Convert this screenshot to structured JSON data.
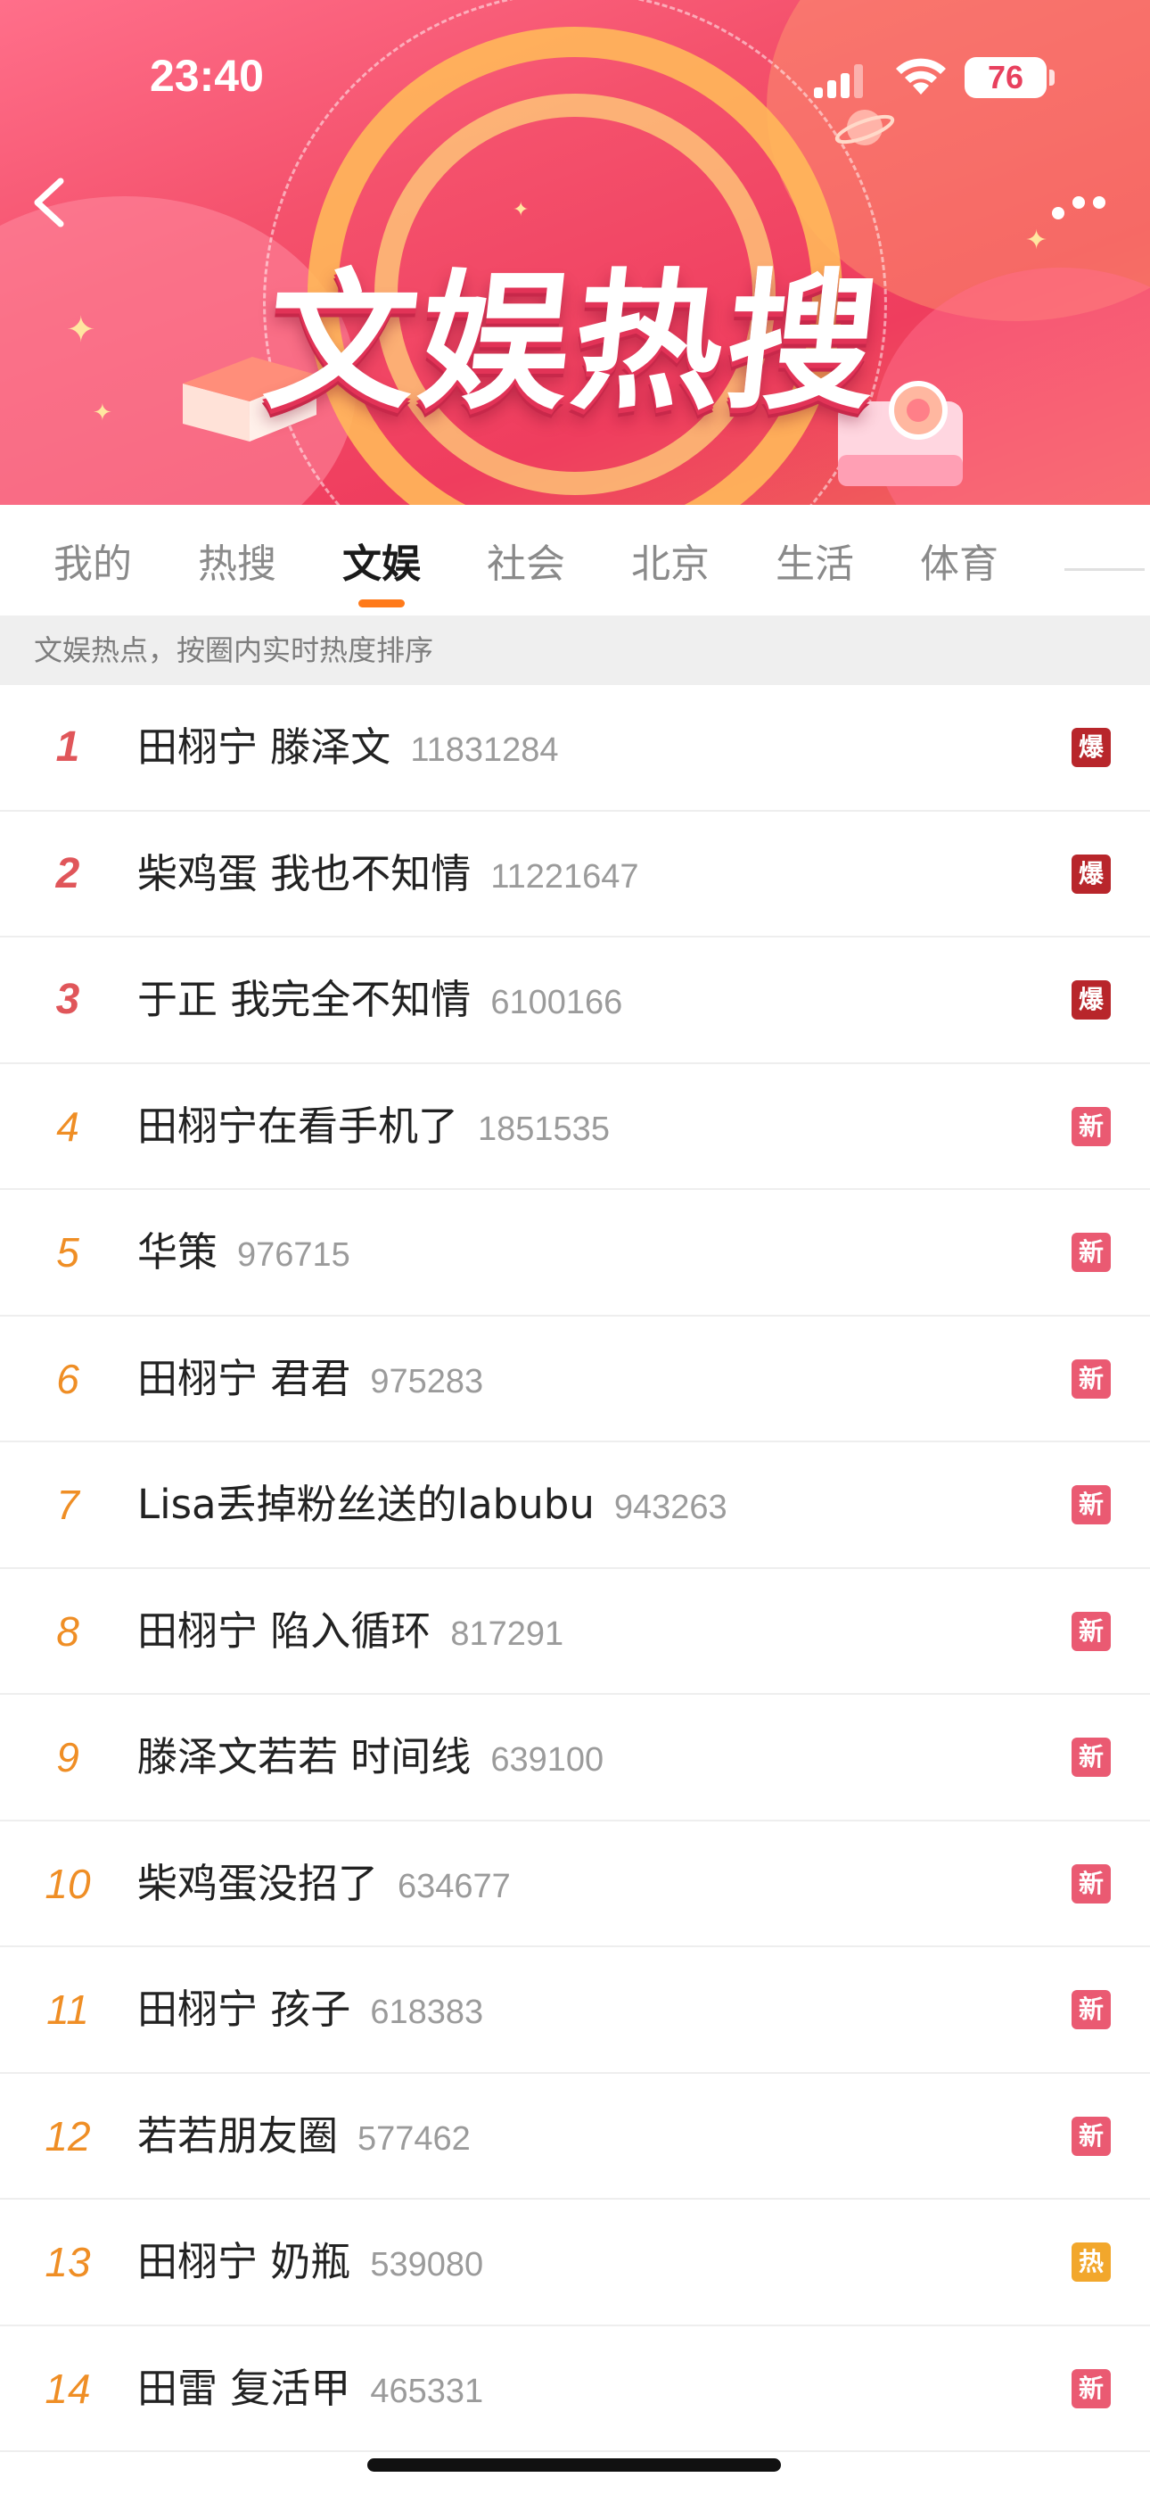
{
  "status_bar": {
    "time": "23:40",
    "battery": "76",
    "icons": [
      "signal-icon",
      "wifi-icon",
      "battery-icon"
    ]
  },
  "banner": {
    "title": "文娱热搜",
    "back_icon": "back-chevron-icon",
    "more_icon": "more-dots-icon"
  },
  "tabs": [
    {
      "label": "我的",
      "active": false
    },
    {
      "label": "热搜",
      "active": false
    },
    {
      "label": "文娱",
      "active": true
    },
    {
      "label": "社会",
      "active": false
    },
    {
      "label": "北京",
      "active": false
    },
    {
      "label": "生活",
      "active": false
    },
    {
      "label": "体育",
      "active": false
    }
  ],
  "hint": "文娱热点，按圈内实时热度排序",
  "colors": {
    "accent": "#ff7a1a",
    "rank_top": "#e0565a",
    "rank": "#ef8e25",
    "badge_bao": "#b8262b",
    "badge_xin": "#ea5a72",
    "badge_re": "#f2a72c"
  },
  "items": [
    {
      "rank": "1",
      "title": "田栩宁 滕泽文",
      "count": "11831284",
      "badge": "爆"
    },
    {
      "rank": "2",
      "title": "柴鸡蛋 我也不知情",
      "count": "11221647",
      "badge": "爆"
    },
    {
      "rank": "3",
      "title": "于正 我完全不知情",
      "count": "6100166",
      "badge": "爆"
    },
    {
      "rank": "4",
      "title": "田栩宁在看手机了",
      "count": "1851535",
      "badge": "新"
    },
    {
      "rank": "5",
      "title": "华策",
      "count": "976715",
      "badge": "新"
    },
    {
      "rank": "6",
      "title": "田栩宁 君君",
      "count": "975283",
      "badge": "新"
    },
    {
      "rank": "7",
      "title": "Lisa丢掉粉丝送的labubu",
      "count": "943263",
      "badge": "新"
    },
    {
      "rank": "8",
      "title": "田栩宁 陷入循环",
      "count": "817291",
      "badge": "新"
    },
    {
      "rank": "9",
      "title": "滕泽文若若 时间线",
      "count": "639100",
      "badge": "新"
    },
    {
      "rank": "10",
      "title": "柴鸡蛋没招了",
      "count": "634677",
      "badge": "新"
    },
    {
      "rank": "11",
      "title": "田栩宁 孩子",
      "count": "618383",
      "badge": "新"
    },
    {
      "rank": "12",
      "title": "若若朋友圈",
      "count": "577462",
      "badge": "新"
    },
    {
      "rank": "13",
      "title": "田栩宁 奶瓶",
      "count": "539080",
      "badge": "热"
    },
    {
      "rank": "14",
      "title": "田雷 复活甲",
      "count": "465331",
      "badge": "新"
    }
  ]
}
